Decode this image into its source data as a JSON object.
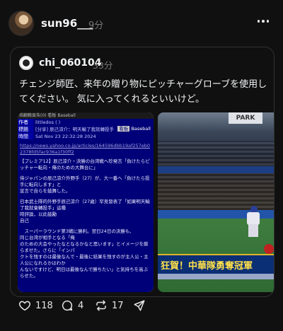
{
  "post": {
    "username": "sun96___",
    "time": "9分",
    "more_icon": "more-horizontal-icon"
  },
  "quoted": {
    "username": "chi_060104",
    "time": "33分",
    "text": "チェンジ師匠、来年の贈り物にピッチャーグローブを使用してください。 気に入ってくれるといいけど。",
    "media": [
      {
        "kind": "forum-screenshot",
        "top_line": "指翻賴頁朱(0)  看板 Baseball",
        "labels": [
          "作者",
          "標題",
          "時間"
        ],
        "author": "littledos (   )",
        "title": "[分享] 辰己涼介：明天輸了我就轉投手",
        "time": "Sat Nov 23 22:32:28 2024",
        "board_label": "看板",
        "board": "Baseball",
        "url": "https://news.yahoo.co.jp/articles/164596dbb19af257eb02378fd5fac936a1f30ff2",
        "paragraphs": [
          "【プレミア12】辰己涼介・決勝の台湾戦へ珍発言「負けたらピッチャー転向・俺のための大舞台に」",
          "侍ジャパンの辰己涼介外野手（27）が、大一番へ「負けたら投手に転向します」と\n宣言で自らを鼓舞した。",
          "日本武士隊的外野手辰己涼介（27歲）罕見發表了「如果明天輸了我就會轉投手」這種\n時評論，以此鼓勵\n自己",
          "　スーパーラウンド第3戦に勝利。翌日24日の決勝も、\n同じ台湾が相手となる「俺\nのための大会やったなとなるかなと思います」とイメージを膨らませた。さらに「インパ\nクトを残すのは最後なんで・最後に結果を残すのが主人公・主人公になれるかはわか\nんないですけど、明日は最後なんで勝ちたい」と気持ちを高ぶらせた。"
        ]
      },
      {
        "kind": "broadcast-frame",
        "sign": "PARK",
        "caption": "狂賀！中華隊勇奪冠軍"
      }
    ]
  },
  "actions": {
    "like_count": "118",
    "comment_count": "4",
    "repost_count": "17"
  }
}
